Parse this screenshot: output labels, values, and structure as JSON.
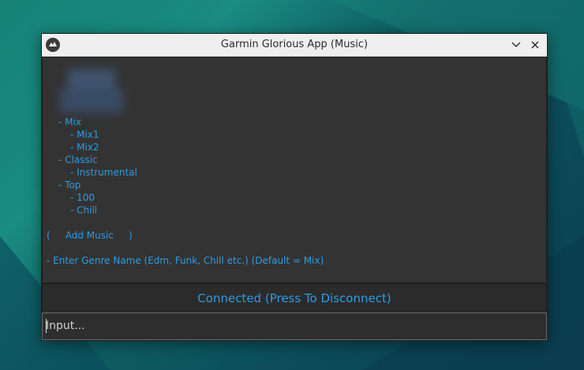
{
  "window": {
    "title": "Garmin Glorious App (Music)"
  },
  "icons": {
    "app": "kivy-logo-icon",
    "minimize": "chevron-down-icon",
    "close": "close-icon"
  },
  "music_tree": [
    {
      "text": "- Mix"
    },
    {
      "text": "- Mix1"
    },
    {
      "text": "- Mix2"
    },
    {
      "text": "- Classic"
    },
    {
      "text": "- Instrumental"
    },
    {
      "text": "- Top"
    },
    {
      "text": "- 100"
    },
    {
      "text": "- Chill"
    }
  ],
  "actions": {
    "add_music": "(     Add Music     )"
  },
  "prompt": {
    "genre": "- Enter Genre Name (Edm, Funk, Chill etc.) (Default = Mix)"
  },
  "status": {
    "connection": "Connected (Press To Disconnect)"
  },
  "input": {
    "placeholder": "Input..."
  },
  "colors": {
    "accent": "#2f9be0",
    "panel": "#333333",
    "titlebar": "#efefef"
  }
}
